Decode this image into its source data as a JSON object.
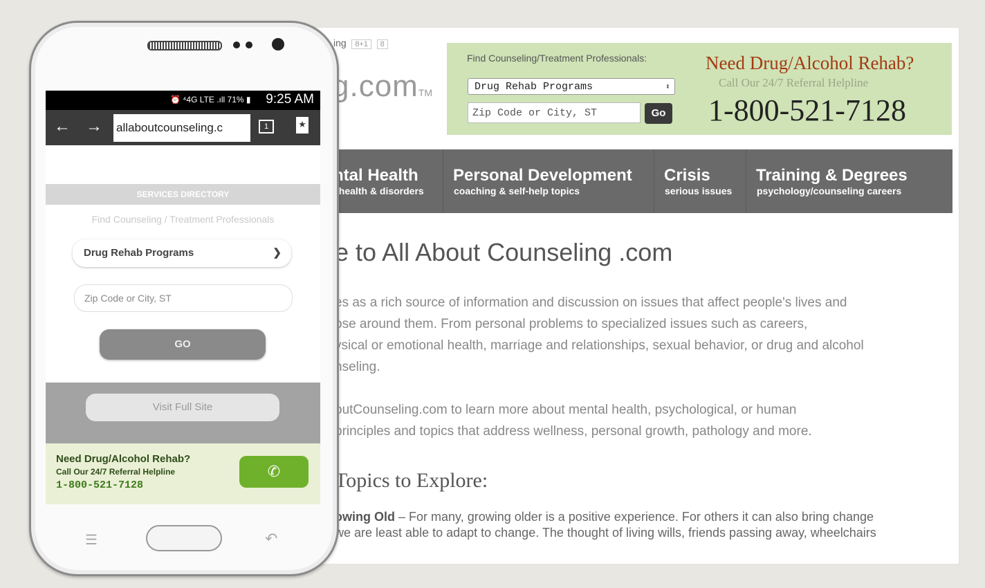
{
  "desktop": {
    "social": {
      "tail": "ing",
      "gplus": "8+1",
      "count": "8"
    },
    "logo": {
      "text": "g.com",
      "tm": "TM"
    },
    "search_box": {
      "label": "Find Counseling/Treatment Professionals:",
      "select_value": "Drug Rehab Programs",
      "zip_placeholder": "Zip Code or City, ST",
      "go_label": "Go"
    },
    "helpline": {
      "headline": "Need Drug/Alcohol Rehab?",
      "subline": "Call Our 24/7 Referral Helpline",
      "phone": "1-800-521-7128"
    },
    "nav": [
      {
        "title": "ntal Health",
        "sub": "l health & disorders"
      },
      {
        "title": "Personal Development",
        "sub": "coaching & self-help topics"
      },
      {
        "title": "Crisis",
        "sub": "serious issues"
      },
      {
        "title": "Training & Degrees",
        "sub": "psychology/counseling careers"
      }
    ],
    "welcome": "e to All About Counseling .com",
    "para1": [
      "es as a rich source of information and discussion on issues that affect people's lives and",
      "ose around them. From personal problems to specialized issues such as careers,",
      "ysical or emotional health, marriage and relationships, sexual behavior, or drug and alcohol",
      "nseling."
    ],
    "para2": [
      "outCounseling.com to learn more about mental health, psychological, or human",
      "principles and topics that address wellness, personal growth, pathology and more."
    ],
    "topics_heading": "Topics to Explore:",
    "growing": {
      "bold": "owing Old",
      "line1": " – For many, growing older is a positive experience. For others it can also bring change",
      "line2": " we are least able to adapt to change. The thought of living wills, friends passing away, wheelchairs"
    }
  },
  "phone": {
    "status": {
      "icons": "⏰ ⁴4G LTE .ıll 71% ▮",
      "time": "9:25 AM"
    },
    "browser": {
      "url": "allaboutcounseling.c"
    },
    "services_header": "SERVICES DIRECTORY",
    "find_label": "Find Counseling / Treatment Professionals",
    "select_value": "Drug Rehab Programs",
    "zip_placeholder": "Zip Code or City, ST",
    "go_label": "GO",
    "visit_label": "Visit Full Site",
    "help": {
      "headline": "Need Drug/Alcohol Rehab?",
      "subline": "Call Our 24/7 Referral Helpline",
      "phone": "1-800-521-7128"
    }
  },
  "colors": {
    "nav_bg": "#6a6a6a",
    "green_box": "#cfe3b6",
    "helpline_red": "#a33a12",
    "call_button": "#6fb12b"
  }
}
